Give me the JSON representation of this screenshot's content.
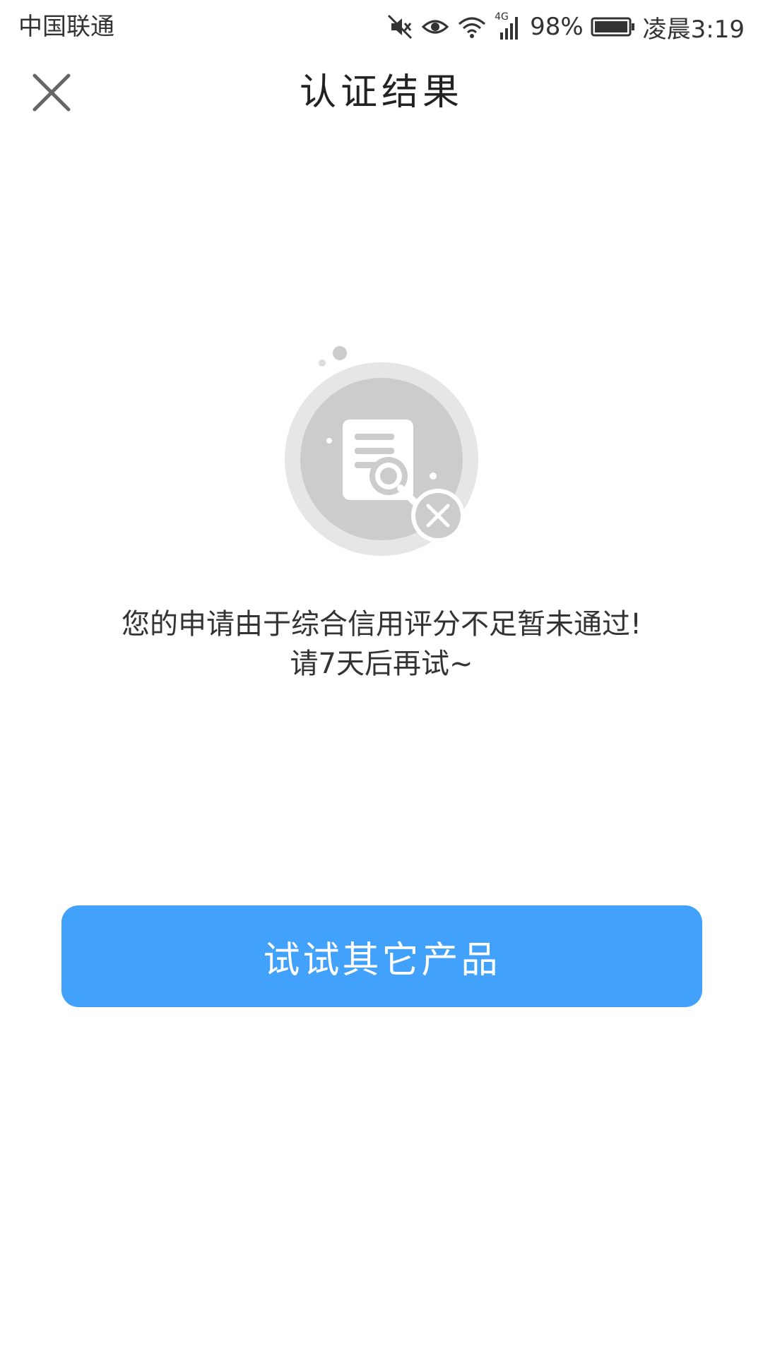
{
  "status_bar": {
    "carrier": "中国联通",
    "network": "4G",
    "battery": "98%",
    "time": "凌晨3:19",
    "icons": [
      "mute-icon",
      "eye-icon",
      "wifi-icon",
      "signal-icon",
      "battery-icon"
    ]
  },
  "header": {
    "title": "认证结果",
    "close_icon": "close-icon"
  },
  "result": {
    "illustration_icon": "document-search-rejected-icon",
    "message_line1": "您的申请由于综合信用评分不足暂未通过!",
    "message_line2": "请7天后再试~"
  },
  "actions": {
    "primary_label": "试试其它产品"
  },
  "colors": {
    "primary": "#42a2fb",
    "illustration_gray": "#cccccc",
    "text": "#333333"
  }
}
